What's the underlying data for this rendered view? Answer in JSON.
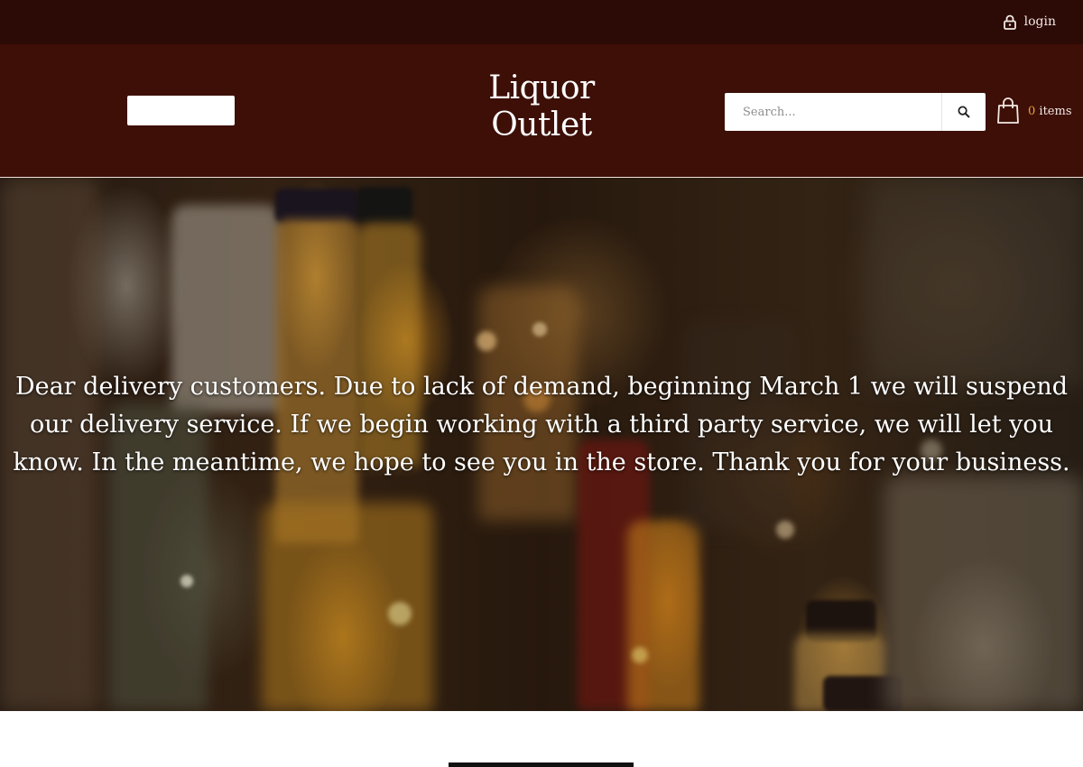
{
  "topbar": {
    "login_label": "login"
  },
  "header": {
    "logo_line1": "Liquor",
    "logo_line2": "Outlet",
    "search": {
      "placeholder": "Search...",
      "button_icon": "search-icon"
    },
    "cart": {
      "icon": "shopping-bag-icon",
      "count": "0",
      "items_label": "items"
    }
  },
  "hero": {
    "message": "Dear delivery customers. Due to lack of demand, beginning March 1 we will suspend our delivery service. If we begin working with a third party service, we will let you know. In the meantime, we hope to see you in the store. Thank you for your business."
  },
  "colors": {
    "topbar": "#2c0a05",
    "header": "#3d0f07",
    "cart_count": "#e8a33c"
  }
}
